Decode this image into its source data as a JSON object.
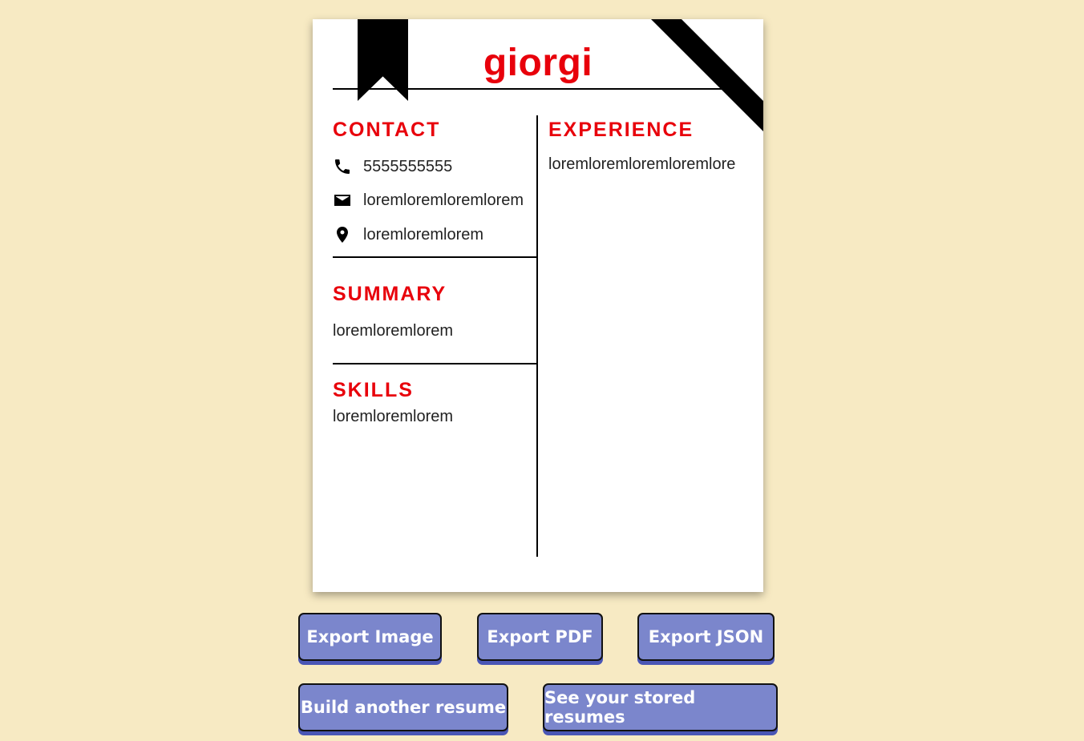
{
  "resume": {
    "name": "giorgi",
    "contact": {
      "title": "CONTACT",
      "phone": "5555555555",
      "email": "loremloremloremlorem",
      "location": "loremloremlorem"
    },
    "summary": {
      "title": "SUMMARY",
      "text": "loremloremlorem"
    },
    "skills": {
      "title": "SKILLS",
      "text": "loremloremlorem"
    },
    "experience": {
      "title": "EXPERIENCE",
      "text": "loremloremloremloremlore"
    },
    "icons": {
      "phone": "phone-icon",
      "email": "mail-icon",
      "location": "location-pin-icon"
    }
  },
  "actions": {
    "export_image": "Export Image",
    "export_pdf": "Export PDF",
    "export_json": "Export JSON",
    "build_another": "Build another resume",
    "stored_resumes": "See your stored resumes"
  },
  "colors": {
    "background": "#f7eac3",
    "accent": "#e8000b",
    "button": "#7b86cc",
    "button_shadow": "#4a56b5"
  }
}
